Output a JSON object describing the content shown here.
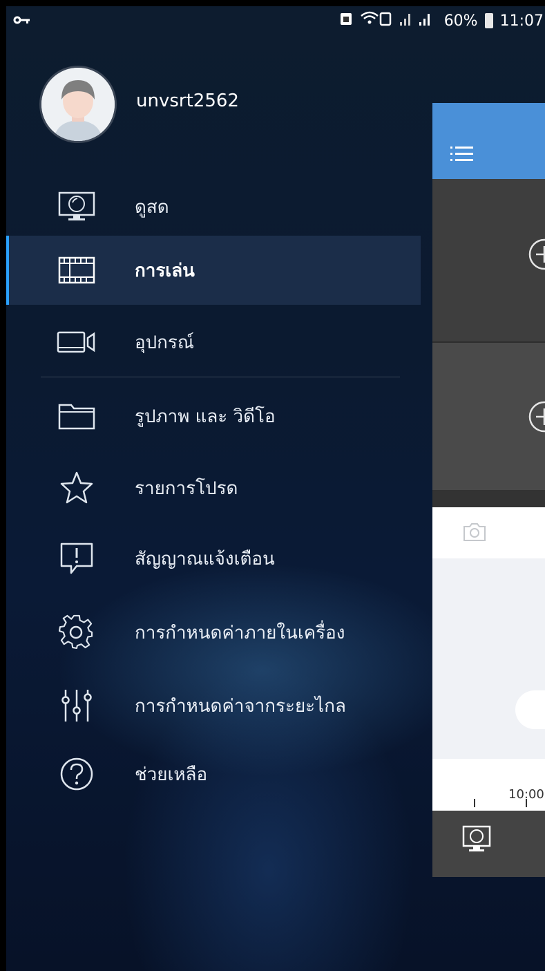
{
  "status_bar": {
    "battery": "60%",
    "time": "11:07"
  },
  "profile": {
    "username": "unvsrt2562"
  },
  "menu": {
    "items": [
      {
        "label": "ดูสด",
        "icon": "monitor-icon"
      },
      {
        "label": "การเล่น",
        "icon": "film-icon",
        "active": true
      },
      {
        "label": "อุปกรณ์",
        "icon": "camera-device-icon"
      },
      {
        "label": "รูปภาพ และ วิดีโอ",
        "icon": "folder-icon"
      },
      {
        "label": "รายการโปรด",
        "icon": "star-icon"
      },
      {
        "label": "สัญญาณแจ้งเตือน",
        "icon": "alert-icon"
      },
      {
        "label": "การกำหนดค่าภายในเครื่อง",
        "icon": "gear-icon"
      },
      {
        "label": "การกำหนดค่าจากระยะไกล",
        "icon": "sliders-icon"
      },
      {
        "label": "ช่วยเหลือ",
        "icon": "help-icon"
      }
    ]
  },
  "preview": {
    "timeline_label": "10:00"
  },
  "colors": {
    "accent": "#2aa1ff",
    "header_blue": "#4a90d8",
    "drawer_bg": "#0b1a30",
    "active_row": "#1b2d49"
  }
}
